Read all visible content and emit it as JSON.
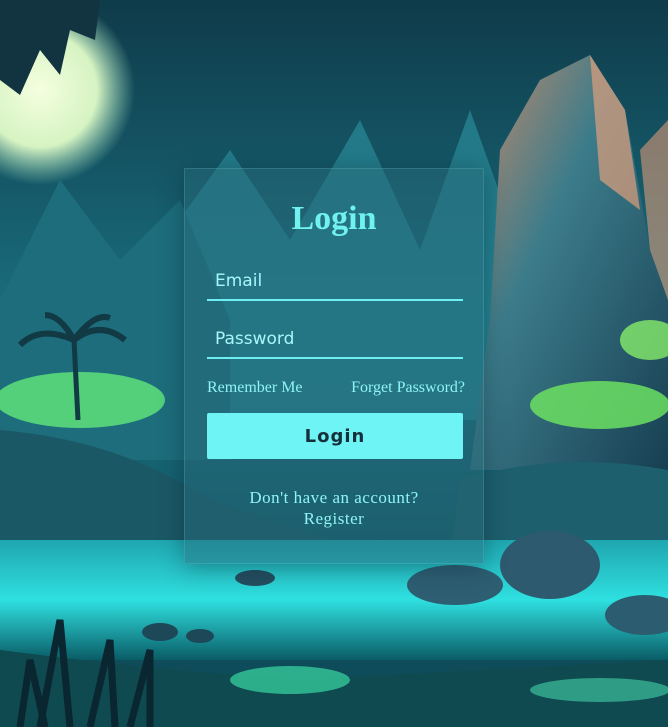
{
  "login": {
    "title": "Login",
    "email_placeholder": "Email",
    "password_placeholder": "Password",
    "remember_me": "Remember Me",
    "forget_password": "Forget Password?",
    "button_label": "Login",
    "no_account": "Don't have an account?",
    "register": "Register"
  },
  "colors": {
    "accent": "#6ef4f4",
    "text": "#8ef4f6",
    "card": "#2a6a78"
  }
}
